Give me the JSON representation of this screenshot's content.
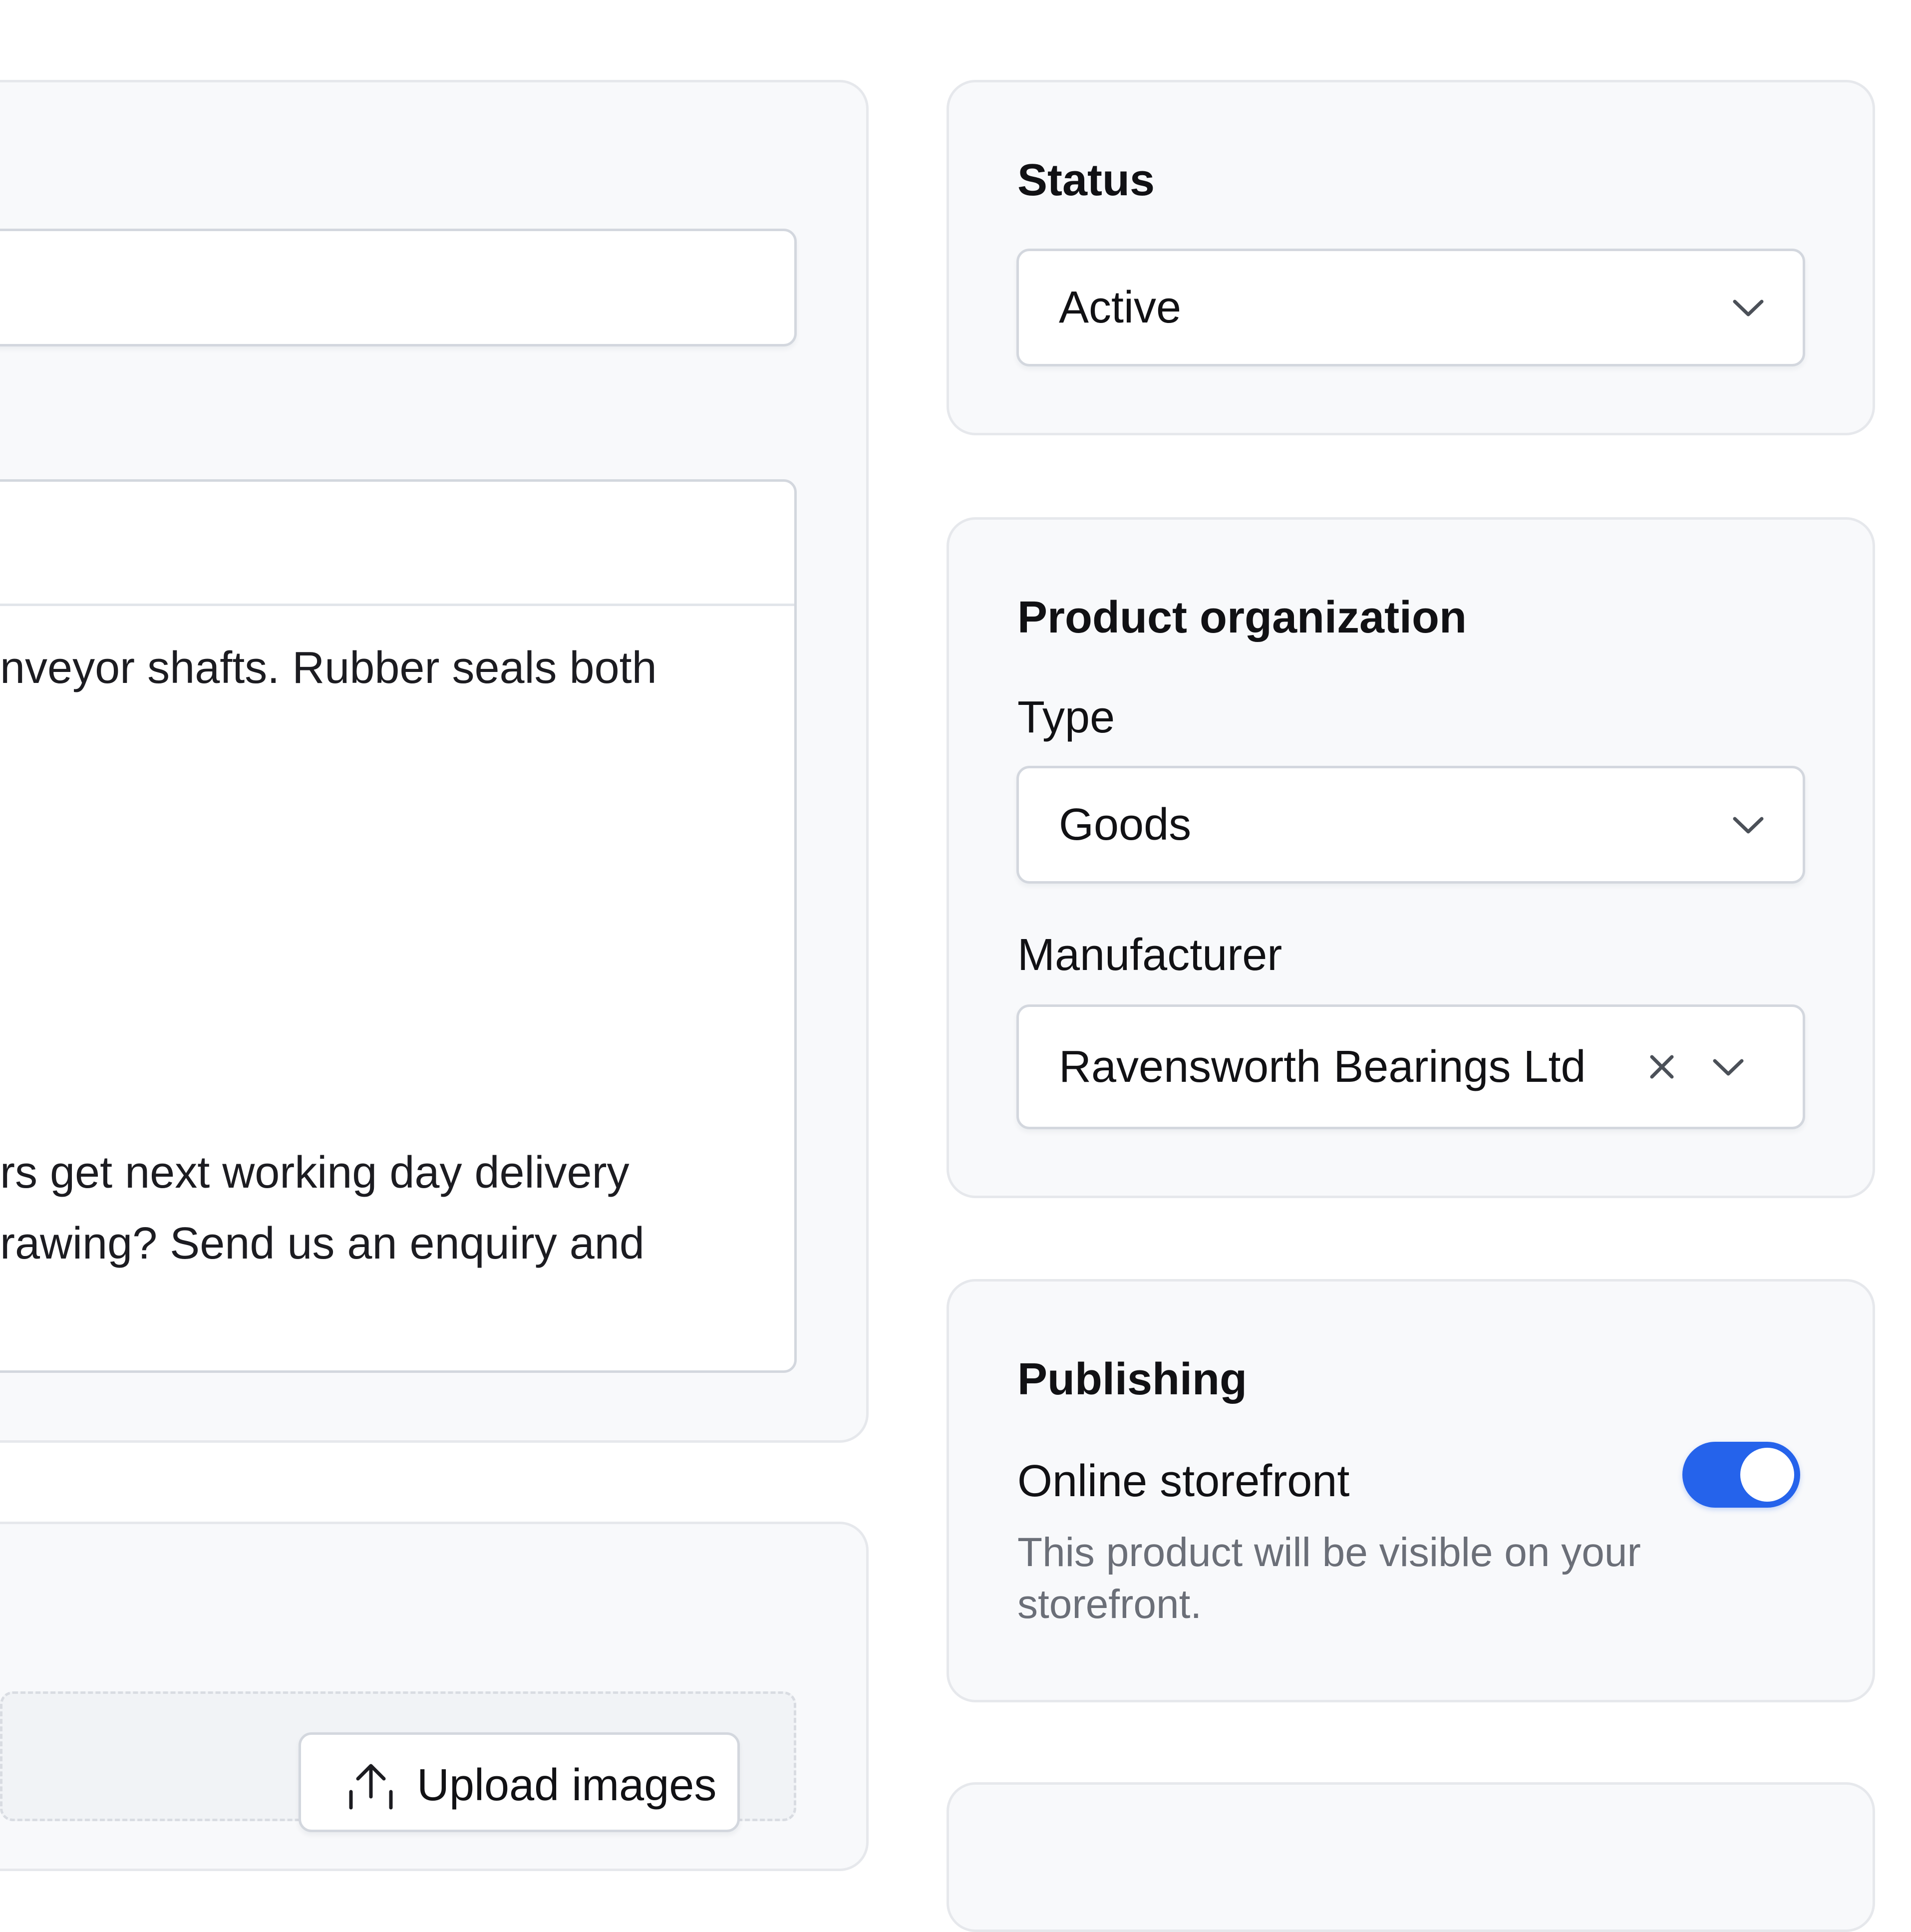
{
  "status": {
    "heading": "Status",
    "selected": "Active"
  },
  "organization": {
    "heading": "Product organization",
    "type_label": "Type",
    "type_value": "Goods",
    "manufacturer_label": "Manufacturer",
    "manufacturer_value": "Ravensworth Bearings Ltd"
  },
  "publishing": {
    "heading": "Publishing",
    "channel_label": "Online storefront",
    "channel_help": "This product will be visible on your storefront.",
    "channel_enabled": true
  },
  "description": {
    "line1": "nveyor shafts. Rubber seals both",
    "line2": "rs get next working day delivery",
    "line3": "rawing? Send us an enquiry and"
  },
  "media": {
    "upload_label": "Upload images"
  },
  "icons": {
    "chevron": "chevron-down-icon",
    "clear": "close-icon",
    "upload": "upload-icon"
  },
  "colors": {
    "accent": "#2563eb",
    "card_bg": "#f8f9fb",
    "border": "#d3d7de"
  }
}
